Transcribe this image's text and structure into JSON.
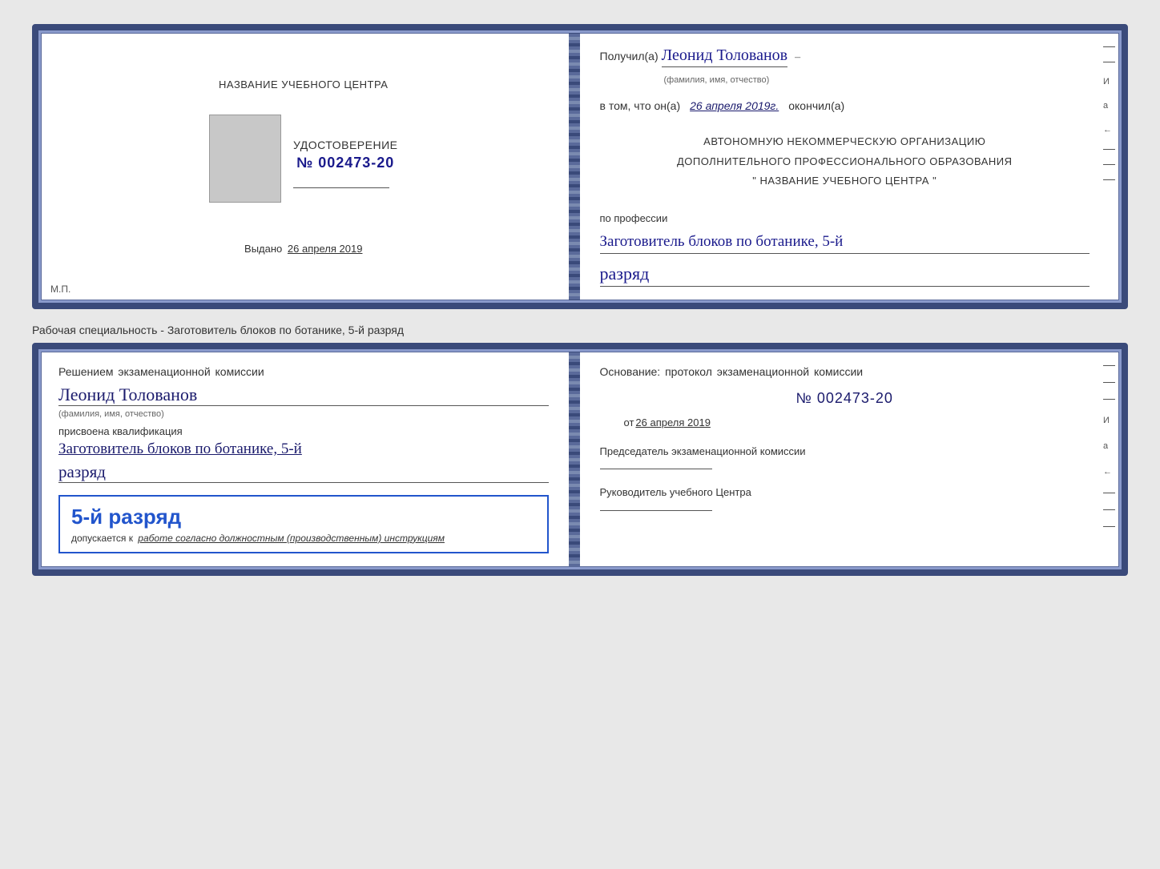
{
  "top_document": {
    "left": {
      "org_name": "НАЗВАНИЕ УЧЕБНОГО ЦЕНТРА",
      "cert_label": "УДОСТОВЕРЕНИЕ",
      "cert_number": "№ 002473-20",
      "issued_label": "Выдано",
      "issued_date": "26 апреля 2019",
      "mp": "М.П."
    },
    "right": {
      "received_prefix": "Получил(а)",
      "received_name": "Леонид Толованов",
      "fio_sub": "(фамилия, имя, отчество)",
      "in_that": "в том, что он(а)",
      "date_value": "26 апреля 2019г.",
      "finished": "окончил(а)",
      "org_line1": "АВТОНОМНУЮ НЕКОММЕРЧЕСКУЮ ОРГАНИЗАЦИЮ",
      "org_line2": "ДОПОЛНИТЕЛЬНОГО ПРОФЕССИОНАЛЬНОГО ОБРАЗОВАНИЯ",
      "org_line3": "\"  НАЗВАНИЕ УЧЕБНОГО ЦЕНТРА  \"",
      "profession_label": "по профессии",
      "profession_value": "Заготовитель блоков по ботанике, 5-й",
      "rank_value": "разряд"
    }
  },
  "separator_text": "Рабочая специальность - Заготовитель блоков по ботанике, 5-й разряд",
  "bottom_document": {
    "left": {
      "decision_text": "Решением  экзаменационной  комиссии",
      "person_name": "Леонид Толованов",
      "fio_sub": "(фамилия, имя, отчество)",
      "assigned_label": "присвоена квалификация",
      "qualification": "Заготовитель блоков по ботанике, 5-й",
      "rank": "разряд",
      "stamp_rank": "5-й разряд",
      "admission_text": "допускается к",
      "admission_italic": "работе согласно должностным (производственным) инструкциям"
    },
    "right": {
      "basis_text": "Основание: протокол экзаменационной  комиссии",
      "protocol_number": "№  002473-20",
      "from_label": "от",
      "from_date": "26 апреля 2019",
      "chairman_label": "Председатель экзаменационной комиссии",
      "director_label": "Руководитель учебного Центра"
    }
  },
  "side_labels": {
    "i": "И",
    "a": "а",
    "arrow": "←"
  }
}
